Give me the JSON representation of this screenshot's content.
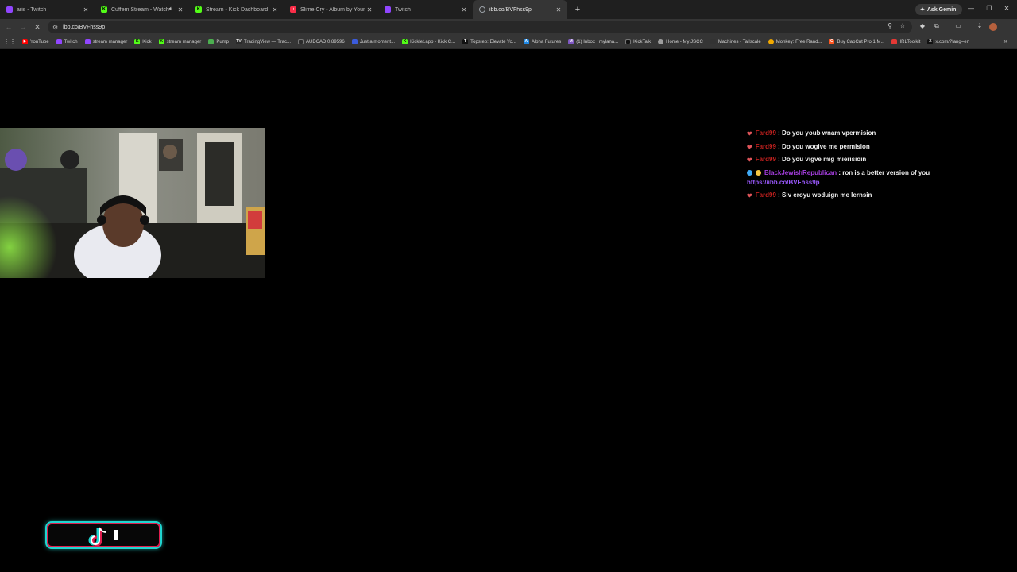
{
  "browser": {
    "tabs": [
      {
        "title": "aris - Twitch",
        "favicon_color": "#9146ff",
        "favicon": "",
        "active": false,
        "audio": false
      },
      {
        "title": "Cuffem Stream - Watch Liv",
        "favicon_color": "#53fc18",
        "favicon": "K",
        "active": false,
        "audio": true
      },
      {
        "title": "Stream - Kick Dashboard",
        "favicon_color": "#53fc18",
        "favicon": "K",
        "active": false,
        "audio": false
      },
      {
        "title": "Slime Cry - Album by Young&",
        "favicon_color": "#fa2d48",
        "favicon": "♪",
        "active": false,
        "audio": false
      },
      {
        "title": "Twitch",
        "favicon_color": "#9146ff",
        "favicon": "",
        "active": false,
        "audio": false
      },
      {
        "title": "ibb.co/BVFhss9p",
        "favicon_color": "#5f6368",
        "favicon": "",
        "active": true,
        "audio": false
      }
    ],
    "new_tab_label": "+",
    "ask_gemini_label": "Ask Gemini",
    "address": "ibb.co/BVFhss9p",
    "bookmarks": [
      {
        "label": "YouTube",
        "color": "#ff0000"
      },
      {
        "label": "Twitch",
        "color": "#9146ff"
      },
      {
        "label": "stream manager",
        "color": "#9146ff"
      },
      {
        "label": "Kick",
        "color": "#53fc18"
      },
      {
        "label": "stream manager",
        "color": "#53fc18"
      },
      {
        "label": "Pump",
        "color": "#4caf50"
      },
      {
        "label": "TradingView — Trac...",
        "color": "#2a2a2a"
      },
      {
        "label": "AUDCAD 0.89596",
        "color": "#2a2a2a"
      },
      {
        "label": "Just a moment...",
        "color": "#3b5bdb"
      },
      {
        "label": "Kicklet.app - Kick C...",
        "color": "#53fc18"
      },
      {
        "label": "Topstep: Elevate Yo...",
        "color": "#111111"
      },
      {
        "label": "Alpha Futures",
        "color": "#1e88e5"
      },
      {
        "label": "(1) Inbox | mylana...",
        "color": "#7e57c2"
      },
      {
        "label": "KickTalk",
        "color": "#111111"
      },
      {
        "label": "Home - My JSCC",
        "color": "#9e9e9e"
      },
      {
        "label": "Machines - Tailscale",
        "color": "#333333"
      },
      {
        "label": "Monkey: Free Rand...",
        "color": "#f2a900"
      },
      {
        "label": "Buy CapCut Pro 1 M...",
        "color": "#ff5722"
      },
      {
        "label": "IRLToolkit",
        "color": "#e53935"
      },
      {
        "label": "x.com/?lang=en",
        "color": "#111111"
      }
    ]
  },
  "chat": {
    "messages": [
      {
        "user": "Fard99",
        "user_color": "#c0201e",
        "badge_color": "#e0555a",
        "text": ": Do you youb wnam vpermision",
        "link": ""
      },
      {
        "user": "Fard99",
        "user_color": "#c0201e",
        "badge_color": "#e0555a",
        "text": ": Do you wogive me permision",
        "link": ""
      },
      {
        "user": "Fard99",
        "user_color": "#c0201e",
        "badge_color": "#e0555a",
        "text": ": Do you vigve mig mierisioin",
        "link": ""
      },
      {
        "user": "BlackJewishRepublican",
        "user_color": "#a63ee0",
        "badge_color": "#3fa9f5",
        "text": ": ron is a better version of you",
        "link": "https://ibb.co/BVFhss9p"
      },
      {
        "user": "Fard99",
        "user_color": "#c0201e",
        "badge_color": "#e0555a",
        "text": ": Siv eroyu woduign me lernsin",
        "link": ""
      }
    ]
  },
  "colors": {
    "page_background": "#000000",
    "tiktok_cyan": "#20d5d0",
    "tiktok_red": "#e01d4e"
  }
}
